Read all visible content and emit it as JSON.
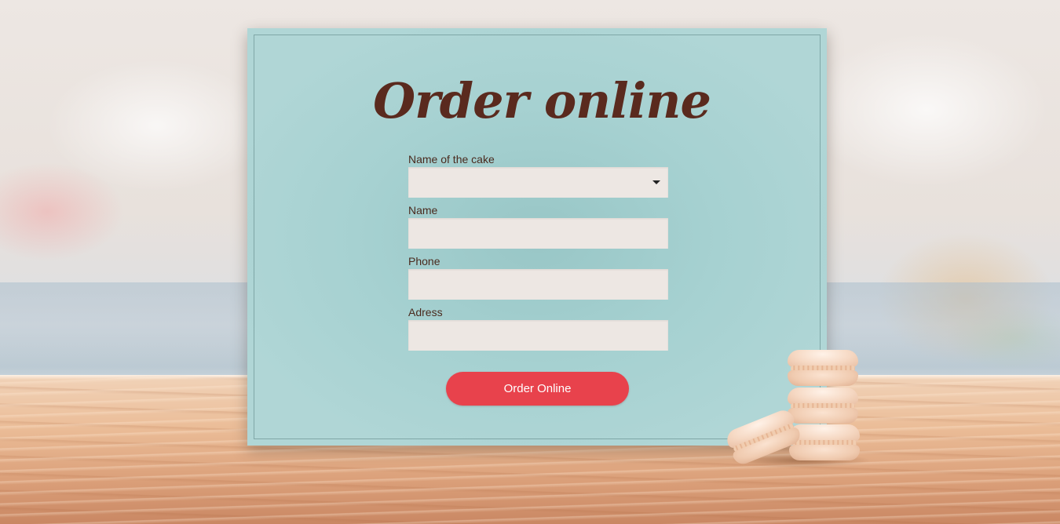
{
  "page": {
    "title": "Order online"
  },
  "form": {
    "cake_label": "Name of the cake",
    "cake_value": "",
    "name_label": "Name",
    "name_value": "",
    "phone_label": "Phone",
    "phone_value": "",
    "address_label": "Adress",
    "address_value": "",
    "submit_label": "Order Online"
  },
  "icons": {
    "dropdown": "caret-down-icon"
  },
  "colors": {
    "card_background": "#a6d1d1",
    "title_color": "#5a2a1e",
    "button_color": "#e8424c",
    "field_background": "#ede7e3"
  }
}
